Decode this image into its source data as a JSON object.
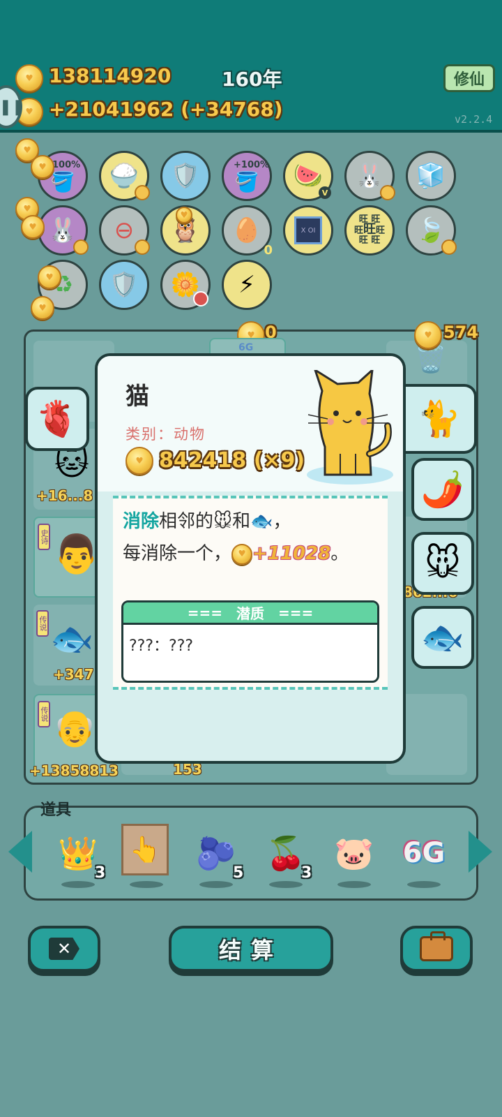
{
  "header": {
    "coins_total": "138114920",
    "coins_rate": "+21041962 (+34768)",
    "year": "160年",
    "cultivate_label": "修仙",
    "version": "v2.2.4",
    "pause_icon": "pause-icon"
  },
  "relics": {
    "percent_a": "100%",
    "percent_b": "+100%",
    "count_egg_tray": "0",
    "grid_chars": [
      "旺",
      "旺",
      "旺",
      "旺",
      "旺",
      "旺",
      "旺"
    ],
    "chip_label": "X OI",
    "badge_v": "V"
  },
  "board": {
    "counter_left": "0",
    "counter_right": "574",
    "tag_6g": "6G",
    "cells": [
      {
        "label": "+16...8"
      },
      {
        "tag": "史诗"
      },
      {
        "tag": "传说",
        "label": "+347"
      },
      {
        "tag": "传说",
        "label": "+13858813"
      },
      {
        "label": "153"
      },
      {
        "label": "1862...6"
      }
    ]
  },
  "popup": {
    "name": "猫",
    "category": "类别：动物",
    "value": "842418 (×9)",
    "desc": {
      "kw_eliminate": "消除",
      "text_adjacent": "相邻的",
      "text_and": "和",
      "text_comma": "，",
      "line2_prefix": "每消除一个，",
      "gain": "+11028",
      "line2_suffix": "。"
    },
    "potential_title": "潜质",
    "potential_dashes": "===",
    "potential_text": "???：???"
  },
  "side_tabs": [
    "cat",
    "chili",
    "mouse",
    "fish"
  ],
  "items": {
    "title": "道具",
    "list": [
      {
        "icon": "crown-icon",
        "count": "3"
      },
      {
        "icon": "pointer-card-icon",
        "count": ""
      },
      {
        "icon": "blueberry-icon",
        "count": "5"
      },
      {
        "icon": "bayberry-icon",
        "count": "3"
      },
      {
        "icon": "piggy-bank-icon",
        "count": ""
      },
      {
        "icon": "6g-icon",
        "label": "6G",
        "count": ""
      }
    ]
  },
  "bottom": {
    "settle_label": "结算",
    "close_icon": "close-icon",
    "bag_icon": "briefcase-icon"
  },
  "colors": {
    "header_bg": "#0f7c78",
    "gold": "#f7c94c",
    "accent_teal": "#27a19b",
    "keyword": "#14a5a0",
    "category": "#d9706c"
  }
}
